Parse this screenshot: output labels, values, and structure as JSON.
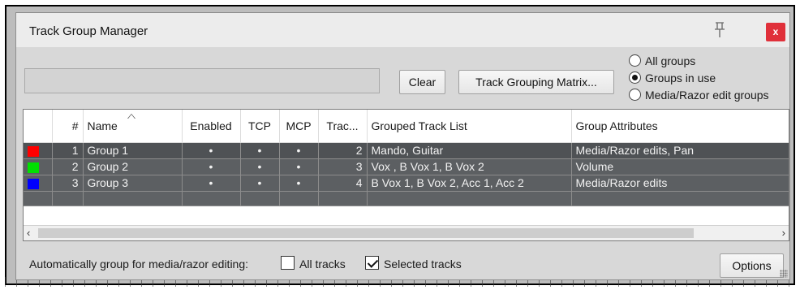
{
  "window": {
    "title": "Track Group Manager",
    "close_label": "x"
  },
  "toolbar": {
    "filter_value": "",
    "clear_label": "Clear",
    "matrix_label": "Track Grouping Matrix..."
  },
  "filter": {
    "options": [
      "All groups",
      "Groups in use",
      "Media/Razor edit groups"
    ],
    "selected": "Groups in use"
  },
  "table": {
    "columns": [
      "",
      "#",
      "Name",
      "Enabled",
      "TCP",
      "MCP",
      "Trac...",
      "Grouped Track List",
      "Group Attributes"
    ],
    "sort_column": "Name",
    "rows": [
      {
        "color": "#ff0000",
        "num": "1",
        "name": "Group 1",
        "enabled": "•",
        "tcp": "•",
        "mcp": "•",
        "tracks": "2",
        "list": "Mando, Guitar",
        "attributes": "Media/Razor edits, Pan"
      },
      {
        "color": "#00e000",
        "num": "2",
        "name": "Group 2",
        "enabled": "•",
        "tcp": "•",
        "mcp": "•",
        "tracks": "3",
        "list": "Vox , B Vox 1, B Vox 2",
        "attributes": "Volume"
      },
      {
        "color": "#0000ff",
        "num": "3",
        "name": "Group 3",
        "enabled": "•",
        "tcp": "•",
        "mcp": "•",
        "tracks": "4",
        "list": "B Vox 1, B Vox 2, Acc 1, Acc 2",
        "attributes": "Media/Razor edits"
      }
    ]
  },
  "scrollbar": {
    "left_arrow": "‹",
    "right_arrow": "›"
  },
  "footer": {
    "auto_group_label": "Automatically group for media/razor editing:",
    "all_tracks_label": "All tracks",
    "all_tracks_checked": false,
    "selected_tracks_label": "Selected tracks",
    "selected_tracks_checked": true,
    "options_label": "Options"
  },
  "colors": {
    "row_bg": "#5c5f62",
    "close_bg": "#e0303a"
  }
}
